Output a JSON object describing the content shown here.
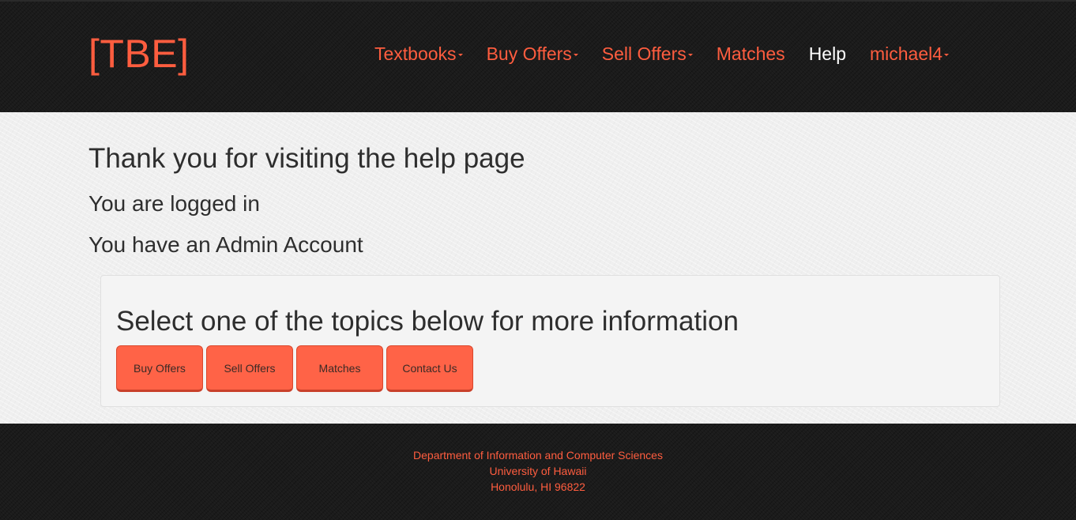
{
  "header": {
    "brand": "[TBE]",
    "nav": [
      {
        "label": "Textbooks",
        "dropdown": true
      },
      {
        "label": "Buy Offers",
        "dropdown": true
      },
      {
        "label": "Sell Offers",
        "dropdown": true
      },
      {
        "label": "Matches",
        "dropdown": false
      },
      {
        "label": "Help",
        "dropdown": false,
        "active": true
      },
      {
        "label": "michael4",
        "dropdown": true
      }
    ]
  },
  "main": {
    "title": "Thank you for visiting the help page",
    "logged_status": "You are logged in",
    "account_type": "You have an Admin Account",
    "panel": {
      "title": "Select one of the topics below for more information",
      "buttons": [
        "Buy Offers",
        "Sell Offers",
        "Matches",
        "Contact Us"
      ]
    }
  },
  "footer": {
    "line1": "Department of Information and Computer Sciences",
    "line2": "University of Hawaii",
    "line3": "Honolulu, HI 96822"
  },
  "colors": {
    "accent": "#ff5d3f",
    "button": "#ff6347",
    "dark_bg": "#1b1b1b",
    "light_bg": "#efefef",
    "active_nav": "#ffffff"
  },
  "icons": {
    "dropdown": "caret-down-icon"
  }
}
